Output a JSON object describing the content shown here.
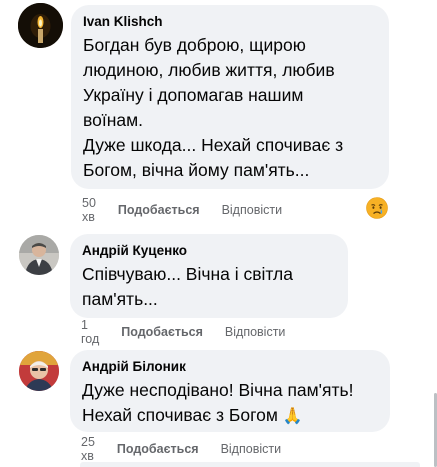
{
  "comments": [
    {
      "author": "Ivan Klishch",
      "text": "Богдан був доброю, щирою\nлюдиною, любив життя, любив\nУкраїну і допомагав нашим\nвоїнам.\nДуже шкода... Нехай спочиває з\nБогом, вічна йому пам'ять...",
      "time": "50 хв",
      "like": "Подобається",
      "reply": "Відповісти",
      "reaction_icon": "crying-face-emoji"
    },
    {
      "author": "Андрій Куценко",
      "text": "Співчуваю... Вічна і світла\nпам'ять...",
      "time": "1 год",
      "like": "Подобається",
      "reply": "Відповісти"
    },
    {
      "author": "Андрій Білоник",
      "text": "Дуже несподівано! Вічна пам'ять!\nНехай спочиває з Богом",
      "text_emoji": "🙏",
      "time": "25 хв",
      "like": "Подобається",
      "reply": "Відповісти"
    }
  ],
  "colors": {
    "bubble": "#f0f2f5",
    "meta": "#65676b",
    "text": "#050505"
  }
}
